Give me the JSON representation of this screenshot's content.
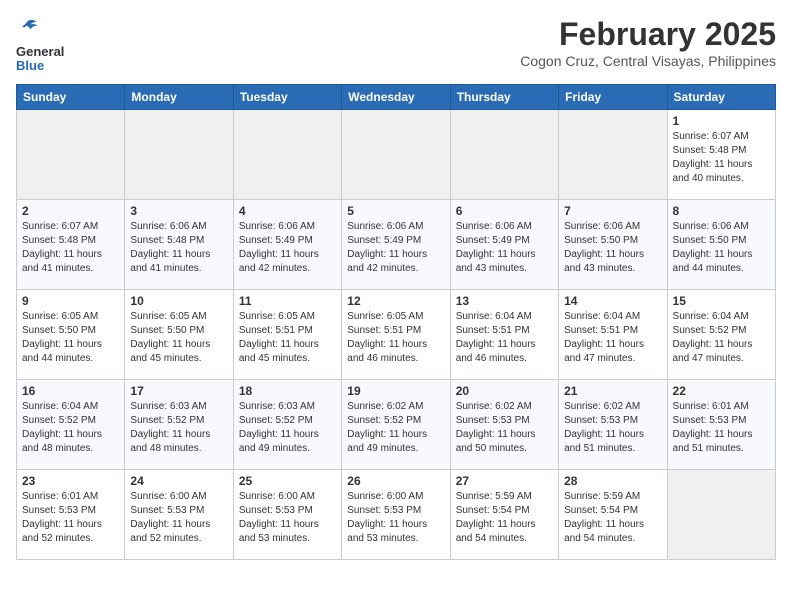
{
  "header": {
    "logo_line1": "General",
    "logo_line2": "Blue",
    "month_year": "February 2025",
    "location": "Cogon Cruz, Central Visayas, Philippines"
  },
  "weekdays": [
    "Sunday",
    "Monday",
    "Tuesday",
    "Wednesday",
    "Thursday",
    "Friday",
    "Saturday"
  ],
  "weeks": [
    [
      {
        "day": "",
        "info": ""
      },
      {
        "day": "",
        "info": ""
      },
      {
        "day": "",
        "info": ""
      },
      {
        "day": "",
        "info": ""
      },
      {
        "day": "",
        "info": ""
      },
      {
        "day": "",
        "info": ""
      },
      {
        "day": "1",
        "info": "Sunrise: 6:07 AM\nSunset: 5:48 PM\nDaylight: 11 hours and 40 minutes."
      }
    ],
    [
      {
        "day": "2",
        "info": "Sunrise: 6:07 AM\nSunset: 5:48 PM\nDaylight: 11 hours and 41 minutes."
      },
      {
        "day": "3",
        "info": "Sunrise: 6:06 AM\nSunset: 5:48 PM\nDaylight: 11 hours and 41 minutes."
      },
      {
        "day": "4",
        "info": "Sunrise: 6:06 AM\nSunset: 5:49 PM\nDaylight: 11 hours and 42 minutes."
      },
      {
        "day": "5",
        "info": "Sunrise: 6:06 AM\nSunset: 5:49 PM\nDaylight: 11 hours and 42 minutes."
      },
      {
        "day": "6",
        "info": "Sunrise: 6:06 AM\nSunset: 5:49 PM\nDaylight: 11 hours and 43 minutes."
      },
      {
        "day": "7",
        "info": "Sunrise: 6:06 AM\nSunset: 5:50 PM\nDaylight: 11 hours and 43 minutes."
      },
      {
        "day": "8",
        "info": "Sunrise: 6:06 AM\nSunset: 5:50 PM\nDaylight: 11 hours and 44 minutes."
      }
    ],
    [
      {
        "day": "9",
        "info": "Sunrise: 6:05 AM\nSunset: 5:50 PM\nDaylight: 11 hours and 44 minutes."
      },
      {
        "day": "10",
        "info": "Sunrise: 6:05 AM\nSunset: 5:50 PM\nDaylight: 11 hours and 45 minutes."
      },
      {
        "day": "11",
        "info": "Sunrise: 6:05 AM\nSunset: 5:51 PM\nDaylight: 11 hours and 45 minutes."
      },
      {
        "day": "12",
        "info": "Sunrise: 6:05 AM\nSunset: 5:51 PM\nDaylight: 11 hours and 46 minutes."
      },
      {
        "day": "13",
        "info": "Sunrise: 6:04 AM\nSunset: 5:51 PM\nDaylight: 11 hours and 46 minutes."
      },
      {
        "day": "14",
        "info": "Sunrise: 6:04 AM\nSunset: 5:51 PM\nDaylight: 11 hours and 47 minutes."
      },
      {
        "day": "15",
        "info": "Sunrise: 6:04 AM\nSunset: 5:52 PM\nDaylight: 11 hours and 47 minutes."
      }
    ],
    [
      {
        "day": "16",
        "info": "Sunrise: 6:04 AM\nSunset: 5:52 PM\nDaylight: 11 hours and 48 minutes."
      },
      {
        "day": "17",
        "info": "Sunrise: 6:03 AM\nSunset: 5:52 PM\nDaylight: 11 hours and 48 minutes."
      },
      {
        "day": "18",
        "info": "Sunrise: 6:03 AM\nSunset: 5:52 PM\nDaylight: 11 hours and 49 minutes."
      },
      {
        "day": "19",
        "info": "Sunrise: 6:02 AM\nSunset: 5:52 PM\nDaylight: 11 hours and 49 minutes."
      },
      {
        "day": "20",
        "info": "Sunrise: 6:02 AM\nSunset: 5:53 PM\nDaylight: 11 hours and 50 minutes."
      },
      {
        "day": "21",
        "info": "Sunrise: 6:02 AM\nSunset: 5:53 PM\nDaylight: 11 hours and 51 minutes."
      },
      {
        "day": "22",
        "info": "Sunrise: 6:01 AM\nSunset: 5:53 PM\nDaylight: 11 hours and 51 minutes."
      }
    ],
    [
      {
        "day": "23",
        "info": "Sunrise: 6:01 AM\nSunset: 5:53 PM\nDaylight: 11 hours and 52 minutes."
      },
      {
        "day": "24",
        "info": "Sunrise: 6:00 AM\nSunset: 5:53 PM\nDaylight: 11 hours and 52 minutes."
      },
      {
        "day": "25",
        "info": "Sunrise: 6:00 AM\nSunset: 5:53 PM\nDaylight: 11 hours and 53 minutes."
      },
      {
        "day": "26",
        "info": "Sunrise: 6:00 AM\nSunset: 5:53 PM\nDaylight: 11 hours and 53 minutes."
      },
      {
        "day": "27",
        "info": "Sunrise: 5:59 AM\nSunset: 5:54 PM\nDaylight: 11 hours and 54 minutes."
      },
      {
        "day": "28",
        "info": "Sunrise: 5:59 AM\nSunset: 5:54 PM\nDaylight: 11 hours and 54 minutes."
      },
      {
        "day": "",
        "info": ""
      }
    ]
  ]
}
